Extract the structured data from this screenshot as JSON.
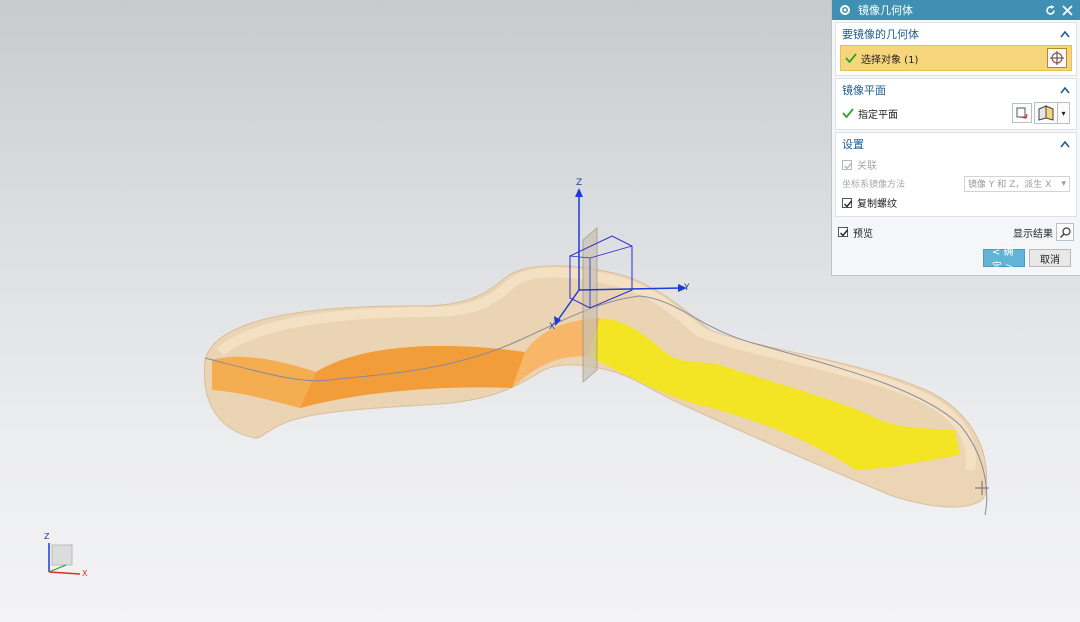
{
  "dialog": {
    "title": "镜像几何体",
    "sections": {
      "geometry": {
        "header": "要镜像的几何体",
        "select_label": "选择对象 (1)"
      },
      "plane": {
        "header": "镜像平面",
        "specify_label": "指定平面"
      },
      "settings": {
        "header": "设置",
        "associative_label": "关联",
        "associative_checked": true,
        "associative_enabled": false,
        "csys_method_label": "坐标系镜像方法",
        "csys_method_value": "镜像 Y 和 Z，派生 X",
        "copy_threads_label": "复制螺纹",
        "copy_threads_checked": true
      }
    },
    "preview_label": "预览",
    "preview_checked": true,
    "show_result_label": "显示结果",
    "ok_label": "< 确定 >",
    "cancel_label": "取消"
  },
  "viewport": {
    "wcs_axes": {
      "x": "X",
      "y": "Y",
      "z": "Z"
    },
    "triad_axes": {
      "x": "X",
      "z": "Z"
    }
  },
  "colors": {
    "title_bar": "#3f90b2",
    "selection_highlight": "#f7d57a",
    "part_body": "#ecd3b0",
    "band_orange": "#f7a640",
    "band_yellow": "#f3e61c",
    "axis_blue": "#1b3dd6",
    "axis_red": "#d8302a"
  }
}
